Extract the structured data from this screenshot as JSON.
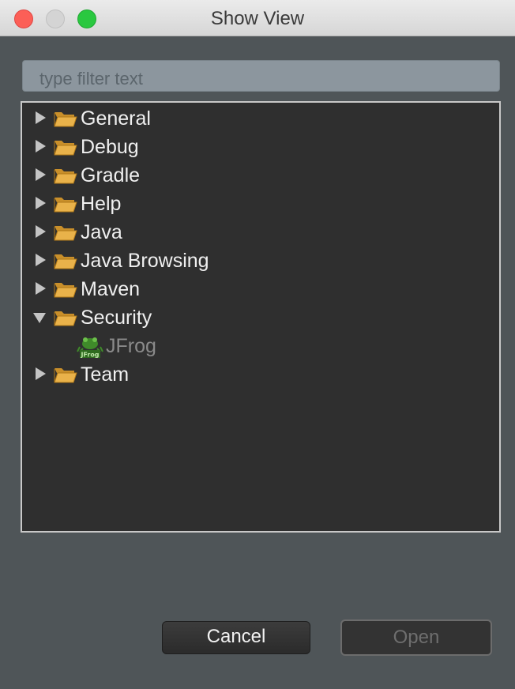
{
  "window": {
    "title": "Show View"
  },
  "filter": {
    "placeholder": "type filter text",
    "value": ""
  },
  "tree": {
    "items": [
      {
        "label": "General",
        "expanded": false
      },
      {
        "label": "Debug",
        "expanded": false
      },
      {
        "label": "Gradle",
        "expanded": false
      },
      {
        "label": "Help",
        "expanded": false
      },
      {
        "label": "Java",
        "expanded": false
      },
      {
        "label": "Java Browsing",
        "expanded": false
      },
      {
        "label": "Maven",
        "expanded": false
      },
      {
        "label": "Security",
        "expanded": true,
        "children": [
          {
            "label": "JFrog",
            "icon": "jfrog-icon",
            "enabled": false
          }
        ]
      },
      {
        "label": "Team",
        "expanded": false
      }
    ]
  },
  "buttons": {
    "cancel": "Cancel",
    "open": "Open",
    "open_enabled": false
  },
  "colors": {
    "folder": "#e9b24a",
    "tree_bg": "#2f2f2f",
    "window_bg": "#4f5558"
  }
}
